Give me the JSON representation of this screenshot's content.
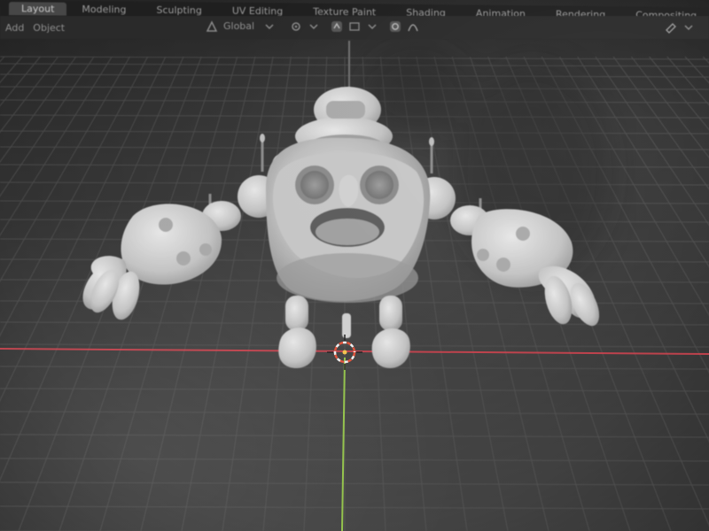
{
  "workspace_tabs": [
    {
      "label": "Layout",
      "active": true
    },
    {
      "label": "Modeling",
      "active": false
    },
    {
      "label": "Sculpting",
      "active": false
    },
    {
      "label": "UV Editing",
      "active": false
    },
    {
      "label": "Texture Paint",
      "active": false
    },
    {
      "label": "Shading",
      "active": false
    },
    {
      "label": "Animation",
      "active": false
    },
    {
      "label": "Rendering",
      "active": false
    },
    {
      "label": "Compositing",
      "active": false
    }
  ],
  "header": {
    "left_menu": [
      "Add",
      "Object"
    ],
    "transform_orientation": "Global",
    "proportional_icon": "proportional-editing-icon"
  },
  "viewport": {
    "x_axis_color": "#d4434f",
    "y_axis_color": "#9bd04a",
    "grid_color": "#5e5e5e",
    "model_color": "#cfcfcf",
    "cursor_color": "#e0523a"
  }
}
